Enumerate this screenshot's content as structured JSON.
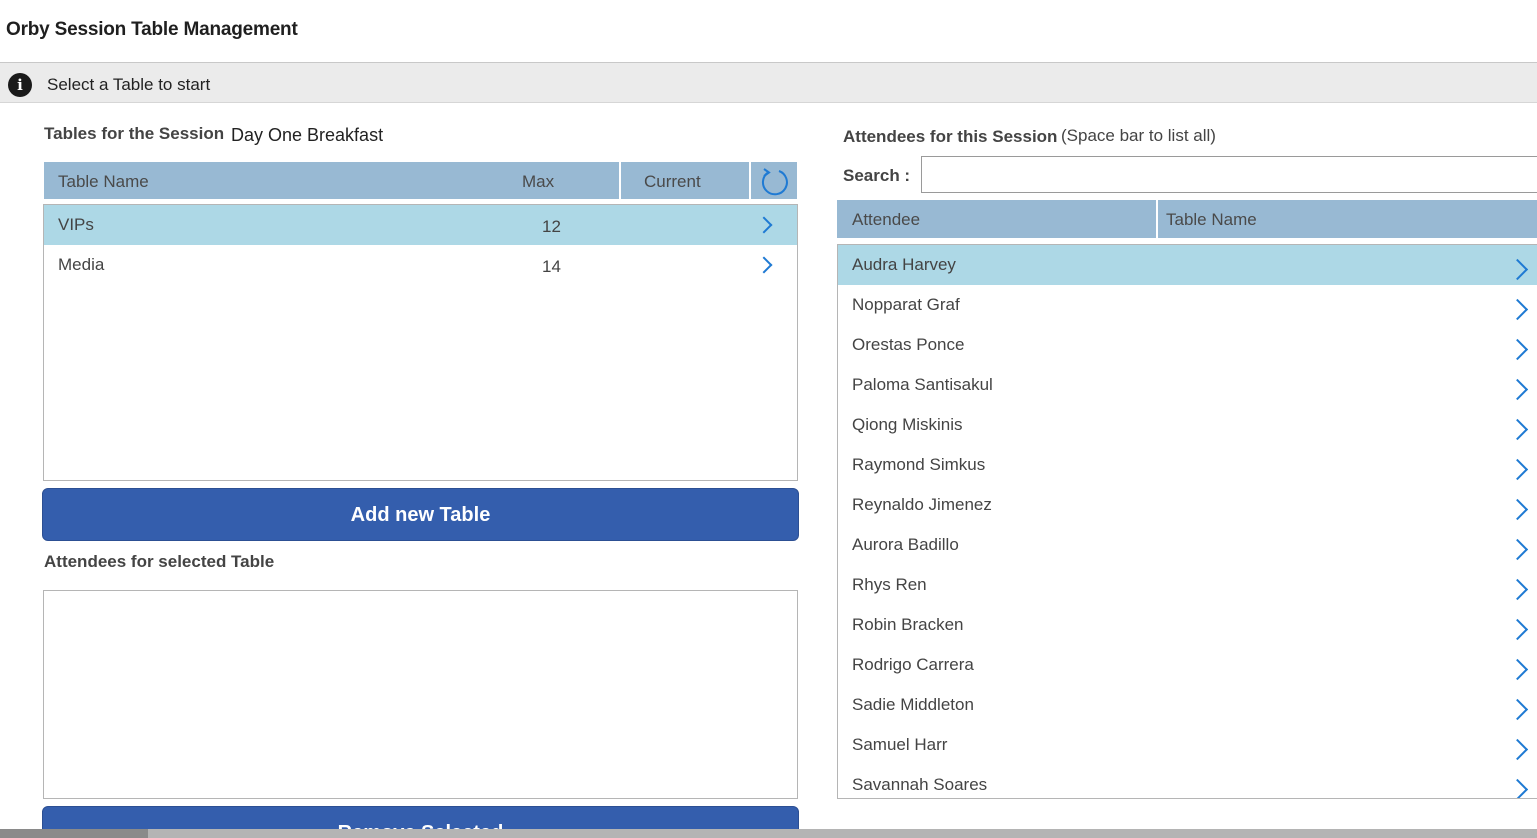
{
  "app": {
    "title": "Orby Session Table Management"
  },
  "info_bar": {
    "icon": "info-icon",
    "message": "Select a Table to start"
  },
  "tables_section": {
    "label": "Tables for the Session",
    "session_name": "Day One Breakfast",
    "columns": [
      "Table Name",
      "Max",
      "Current"
    ],
    "refresh_icon": "refresh-icon",
    "rows": [
      {
        "name": "VIPs",
        "max": "12",
        "current": "",
        "selected": true
      },
      {
        "name": "Media",
        "max": "14",
        "current": "",
        "selected": false
      }
    ]
  },
  "add_table_button": {
    "label": "Add new Table"
  },
  "selected_table_section": {
    "label": "Attendees for selected Table"
  },
  "remove_button": {
    "label": "Remove Selected"
  },
  "attendees_section": {
    "label": "Attendees for this Session",
    "hint": "(Space bar to list all)",
    "search_label": "Search :",
    "search_value": "",
    "columns": [
      "Attendee",
      "Table Name"
    ],
    "rows": [
      {
        "name": "Audra Harvey",
        "selected": true
      },
      {
        "name": "Nopparat Graf"
      },
      {
        "name": "Orestas Ponce"
      },
      {
        "name": "Paloma Santisakul"
      },
      {
        "name": "Qiong Miskinis"
      },
      {
        "name": "Raymond Simkus"
      },
      {
        "name": "Reynaldo Jimenez"
      },
      {
        "name": "Aurora Badillo"
      },
      {
        "name": "Rhys Ren"
      },
      {
        "name": "Robin Bracken"
      },
      {
        "name": "Rodrigo Carrera"
      },
      {
        "name": "Sadie Middleton"
      },
      {
        "name": "Samuel Harr"
      },
      {
        "name": "Savannah Soares"
      }
    ]
  },
  "colors": {
    "header_blue": "#98b9d3",
    "selected_row": "#add8e6",
    "button_blue": "#345ead",
    "chevron_blue": "#1f7ad3"
  }
}
